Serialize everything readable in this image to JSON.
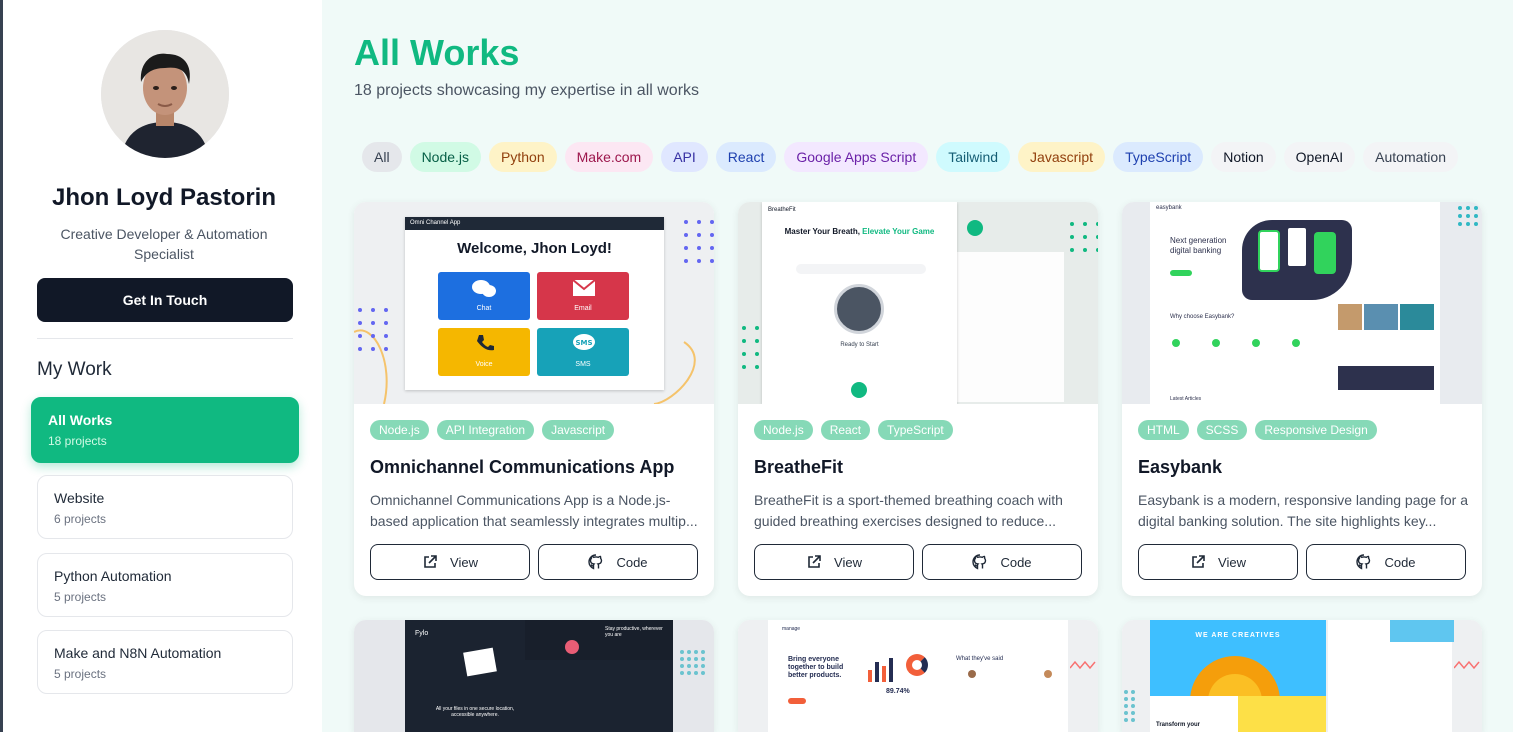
{
  "profile": {
    "name": "Jhon Loyd Pastorin",
    "role": "Creative Developer & Automation Specialist",
    "cta_label": "Get In Touch"
  },
  "nav": {
    "section_title": "My Work",
    "categories": [
      {
        "label": "All Works",
        "count": "18 projects",
        "active": true
      },
      {
        "label": "Website",
        "count": "6 projects"
      },
      {
        "label": "Python Automation",
        "count": "5 projects"
      },
      {
        "label": "Make and N8N Automation",
        "count": "5 projects"
      }
    ]
  },
  "main": {
    "title": "All Works",
    "subtitle": "18 projects showcasing my expertise in all works",
    "filters": [
      {
        "label": "All",
        "bg": "#e5e7eb",
        "color": "#374151"
      },
      {
        "label": "Node.js",
        "bg": "#d1fae5",
        "color": "#065f46"
      },
      {
        "label": "Python",
        "bg": "#fef3c7",
        "color": "#92400e"
      },
      {
        "label": "Make.com",
        "bg": "#fce7f3",
        "color": "#9d174d"
      },
      {
        "label": "API",
        "bg": "#e0e7ff",
        "color": "#3730a3"
      },
      {
        "label": "React",
        "bg": "#dbeafe",
        "color": "#1e40af"
      },
      {
        "label": "Google Apps Script",
        "bg": "#f3e8ff",
        "color": "#6b21a8"
      },
      {
        "label": "Tailwind",
        "bg": "#cffafe",
        "color": "#155e75"
      },
      {
        "label": "Javascript",
        "bg": "#fef3c7",
        "color": "#92400e"
      },
      {
        "label": "TypeScript",
        "bg": "#dbeafe",
        "color": "#1e40af"
      },
      {
        "label": "Notion",
        "bg": "#f3f4f6",
        "color": "#111827"
      },
      {
        "label": "OpenAI",
        "bg": "#f3f4f6",
        "color": "#111827"
      },
      {
        "label": "Automation",
        "bg": "#f3f4f6",
        "color": "#374151"
      }
    ],
    "projects": [
      {
        "title": "Omnichannel Communications App",
        "tags": [
          "Node.js",
          "API Integration",
          "Javascript"
        ],
        "description": "Omnichannel Communications App is a Node.js-based application that seamlessly integrates multip...",
        "view_label": "View",
        "code_label": "Code",
        "preview": {
          "app_name": "Omni Channel App",
          "heading": "Welcome, Jhon Loyd!",
          "tiles": [
            "Chat",
            "Email",
            "Voice",
            "SMS"
          ]
        }
      },
      {
        "title": "BreatheFit",
        "tags": [
          "Node.js",
          "React",
          "TypeScript"
        ],
        "description": "BreatheFit is a sport-themed breathing coach with guided breathing exercises designed to reduce...",
        "view_label": "View",
        "code_label": "Code",
        "preview": {
          "app_name": "BreatheFit",
          "heading_a": "Master Your Breath, ",
          "heading_b": "Elevate Your Game",
          "status": "Ready to Start"
        }
      },
      {
        "title": "Easybank",
        "tags": [
          "HTML",
          "SCSS",
          "Responsive Design"
        ],
        "description": "Easybank is a modern, responsive landing page for a digital banking solution. The site highlights key...",
        "view_label": "View",
        "code_label": "Code",
        "preview": {
          "app_name": "easybank",
          "hero": "Next generation digital banking",
          "section": "Why choose Easybank?",
          "articles": "Latest Articles"
        }
      }
    ],
    "partial_previews": [
      {
        "brand": "Fylo",
        "text_a": "Stay productive, wherever you are",
        "text_b": "All your files in one secure location, accessible anywhere."
      },
      {
        "brand": "manage",
        "text_a": "Bring everyone together to build better products.",
        "stat": "89.74%",
        "text_b": "What they've said"
      },
      {
        "text_a": "WE ARE CREATIVES",
        "text_b": "Transform your"
      }
    ]
  }
}
